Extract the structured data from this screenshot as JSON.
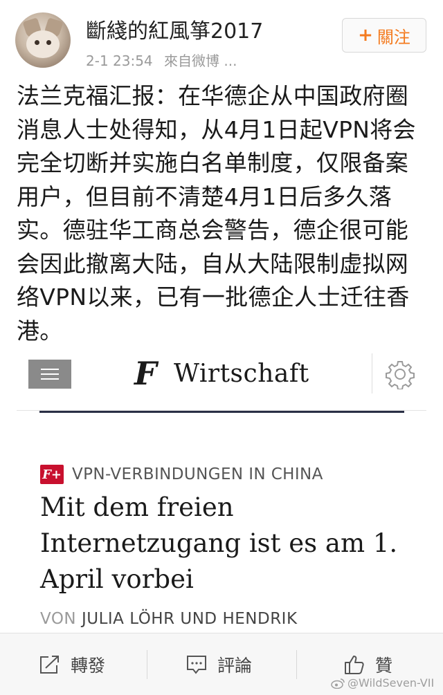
{
  "post": {
    "username": "斷綫的紅風箏2017",
    "date": "2-1 23:54",
    "source": "來自微博 ...",
    "follow_label": "關注",
    "text": "法兰克福汇报：在华德企从中国政府圈消息人士处得知，从4月1日起VPN将会完全切断并实施白名单制度，仅限备案用户，但目前不清楚4月1日后多久落实。德驻华工商总会警告，德企很可能会因此撤离大陆，自从大陆限制虚拟网络VPN以来，已有一批德企人士迁往香港。"
  },
  "article": {
    "section_title": "Wirtschaft",
    "logo_glyph": "F",
    "plus_badge": "F+",
    "kicker": "VPN-VERBINDUNGEN IN CHINA",
    "headline": "Mit dem freien Internetzugang ist es am 1. April vorbei",
    "byline_prefix": "VON",
    "byline_names": "JULIA LÖHR UND HENDRIK"
  },
  "actions": {
    "repost_label": "轉發",
    "comment_label": "評論",
    "like_label": "贊",
    "watermark": "@WildSeven-VII"
  },
  "icons": [
    "avatar",
    "plus-icon",
    "hamburger-menu-icon",
    "faz-logo",
    "gear-icon",
    "faz-plus-badge",
    "repost-icon",
    "comment-icon",
    "like-icon",
    "weibo-logo-icon"
  ],
  "colors": {
    "accent_orange": "#f47b1f",
    "faz_red": "#c8102e",
    "faz_navy": "#2a2f45",
    "meta_gray": "#9a9a9a"
  }
}
